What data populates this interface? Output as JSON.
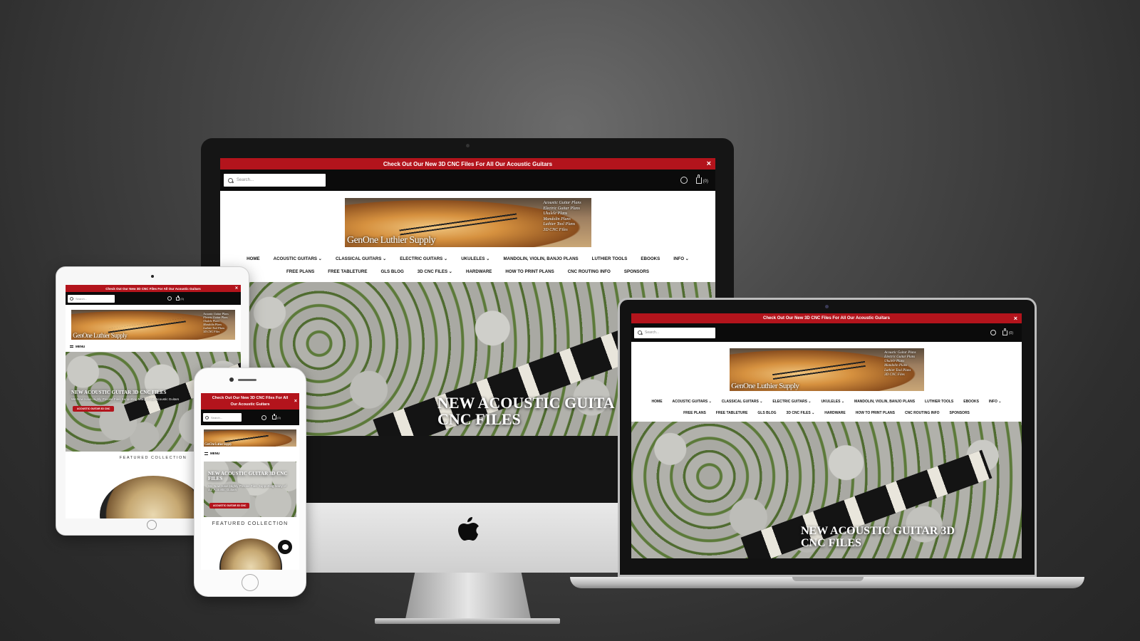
{
  "announcement": "Check Out Our New 3D CNC Files For All Our Acoustic Guitars",
  "announcement_short": "Check Out Our New 3D CNC Files For All Our Acoustic Guitars",
  "close_glyph": "×",
  "search_placeholder": "Search...",
  "cart_count": "(0)",
  "brand": "GenOne Luthier Supply",
  "banner_lines": [
    "Acoustic Guitar Plans",
    "Electric Guitar Plans",
    "Ukulele Plans",
    "Mandolin Plans",
    "Luthier Tool Plans",
    "3D CNC Files"
  ],
  "nav_row1": [
    "HOME",
    "ACOUSTIC GUITARS ⌄",
    "CLASSICAL GUITARS ⌄",
    "ELECTRIC GUITARS ⌄",
    "UKULELES ⌄",
    "MANDOLIN, VIOLIN, BANJO PLANS",
    "LUTHIER TOOLS",
    "EBOOKS",
    "INFO ⌄"
  ],
  "nav_row2": [
    "FREE PLANS",
    "FREE TABLETURE",
    "GLS BLOG",
    "3D CNC FILES ⌄",
    "HARDWARE",
    "HOW TO PRINT PLANS",
    "CNC ROUTING INFO",
    "SPONSORS"
  ],
  "hero_title_desktop": "NEW ACOUSTIC GUITA\nCNC FILES",
  "hero_title_laptop": "NEW ACOUSTIC GUITAR 3D\nCNC FILES",
  "hero_title_mobile": "NEW ACOUSTIC GUITAR 3D CNC FILES",
  "hero_subtitle": "We Now Have Highly Precise Files Supporting Many of our Acoustic Guitars",
  "cta_label": "ACOUSTIC GUITAR 3D CNC",
  "menu_label": "MENU",
  "featured_collection": "FEATURED COLLECTION",
  "colors": {
    "brand_red": "#b3141c",
    "topbar": "#0b0b0b"
  },
  "icons": [
    "search-icon",
    "account-icon",
    "cart-icon",
    "close-icon",
    "apple-logo-icon",
    "chat-icon",
    "menu-icon"
  ]
}
